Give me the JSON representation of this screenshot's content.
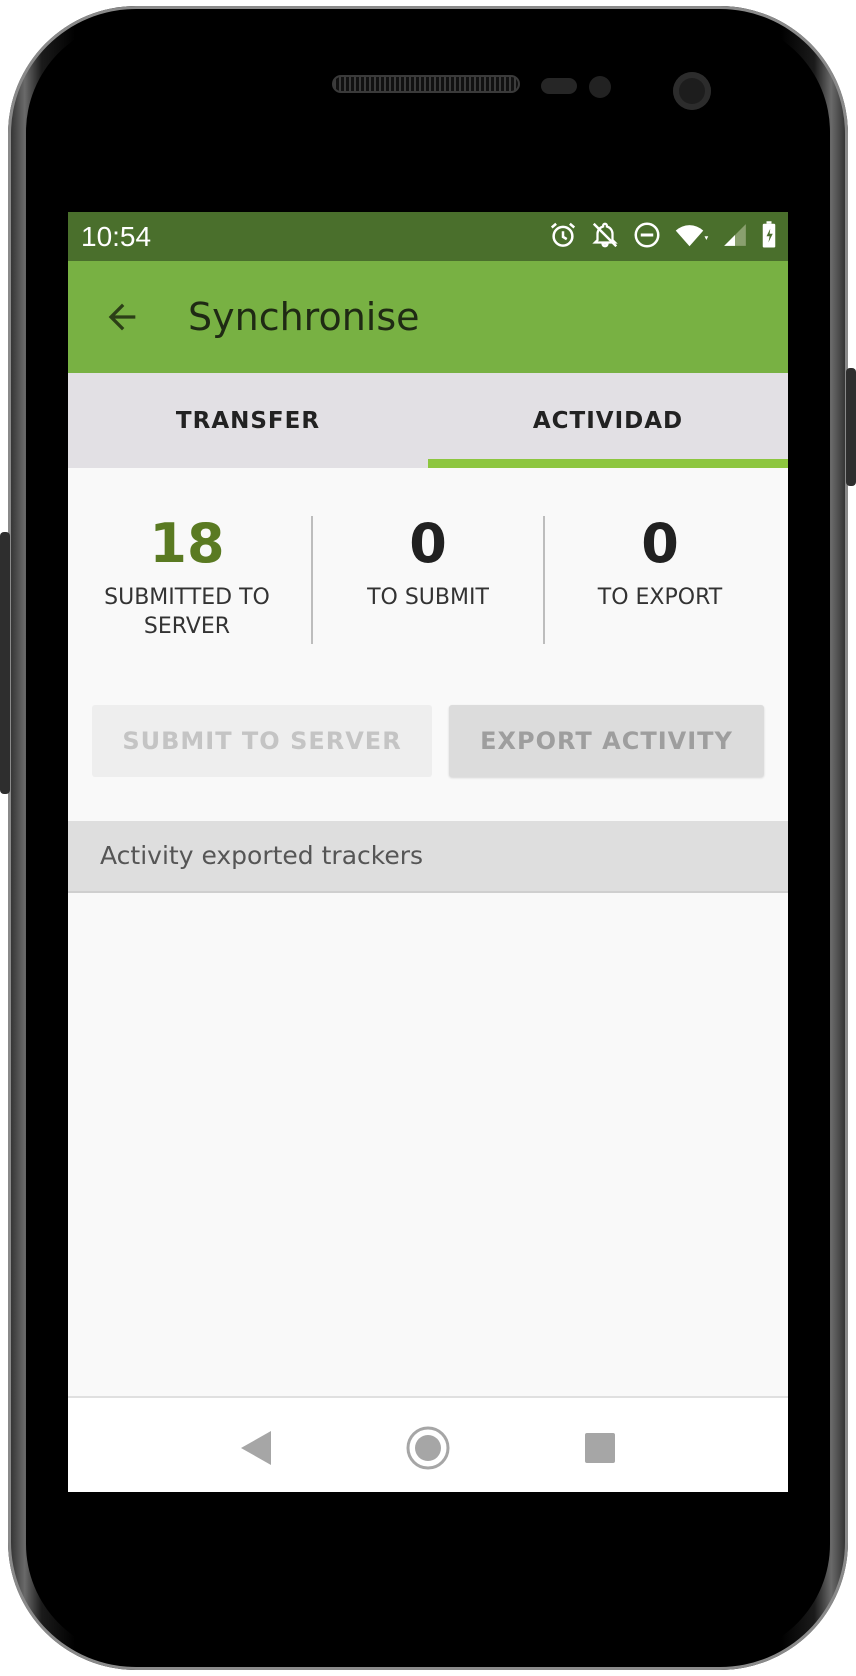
{
  "status_bar": {
    "time": "10:54",
    "icons": [
      "alarm-icon",
      "notifications-off-icon",
      "do-not-disturb-icon",
      "wifi-icon",
      "cell-signal-icon",
      "battery-charging-icon"
    ]
  },
  "toolbar": {
    "back_icon": "arrow-back-icon",
    "title": "Synchronise"
  },
  "tabs": [
    {
      "label": "TRANSFER",
      "selected": false
    },
    {
      "label": "ACTIVIDAD",
      "selected": true
    }
  ],
  "stats": [
    {
      "value": "18",
      "label": "SUBMITTED TO SERVER",
      "color": "#5a7a22"
    },
    {
      "value": "0",
      "label": "TO SUBMIT"
    },
    {
      "value": "0",
      "label": "TO EXPORT"
    }
  ],
  "buttons": {
    "submit_label": "SUBMIT TO SERVER",
    "export_label": "EXPORT ACTIVITY"
  },
  "section": {
    "title": "Activity exported trackers"
  },
  "colors": {
    "status_bar": "#4a6f2c",
    "toolbar": "#78b143",
    "tab_indicator": "#8dc63f",
    "tabs_bg": "#e2e0e4"
  },
  "nav_bar": [
    "back-nav-icon",
    "home-nav-icon",
    "recents-nav-icon"
  ]
}
